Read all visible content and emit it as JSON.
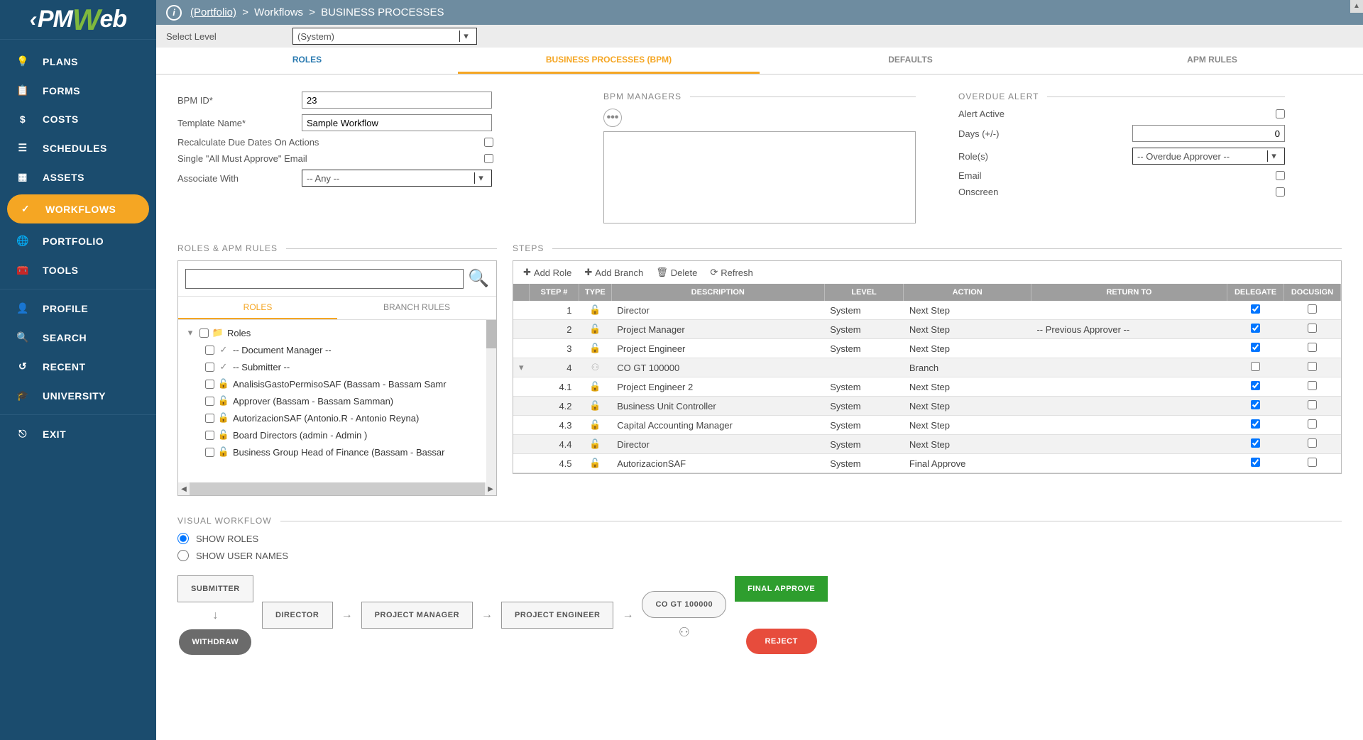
{
  "logo": {
    "pre": "PM",
    "w": "W",
    "post": "eb"
  },
  "sidebar": {
    "items": [
      {
        "label": "PLANS"
      },
      {
        "label": "FORMS"
      },
      {
        "label": "COSTS"
      },
      {
        "label": "SCHEDULES"
      },
      {
        "label": "ASSETS"
      },
      {
        "label": "WORKFLOWS"
      },
      {
        "label": "PORTFOLIO"
      },
      {
        "label": "TOOLS"
      }
    ],
    "bottom": [
      {
        "label": "PROFILE"
      },
      {
        "label": "SEARCH"
      },
      {
        "label": "RECENT"
      },
      {
        "label": "UNIVERSITY"
      }
    ],
    "exit": "EXIT"
  },
  "breadcrumb": {
    "portfolio": "(Portfolio)",
    "workflows": "Workflows",
    "bp": "BUSINESS PROCESSES"
  },
  "selectLevel": {
    "label": "Select Level",
    "value": "(System)"
  },
  "tabs": {
    "roles": "ROLES",
    "bpm": "BUSINESS PROCESSES (BPM)",
    "defaults": "DEFAULTS",
    "apm": "APM RULES"
  },
  "form": {
    "bpm_id_label": "BPM ID*",
    "bpm_id": "23",
    "template_label": "Template Name*",
    "template": "Sample Workflow",
    "recalc": "Recalculate Due Dates On Actions",
    "single": "Single \"All Must Approve\" Email",
    "associate_label": "Associate With",
    "associate": "-- Any --"
  },
  "managers": {
    "title": "BPM MANAGERS"
  },
  "alert": {
    "title": "OVERDUE ALERT",
    "active": "Alert Active",
    "days_label": "Days (+/-)",
    "days": "0",
    "roles_label": "Role(s)",
    "roles": "-- Overdue Approver --",
    "email": "Email",
    "onscreen": "Onscreen"
  },
  "rolesPanel": {
    "title": "ROLES & APM RULES",
    "tab_roles": "ROLES",
    "tab_branch": "BRANCH RULES",
    "root": "Roles",
    "items": [
      "-- Document Manager --",
      "-- Submitter --",
      "AnalisisGastoPermisoSAF (Bassam - Bassam Samr",
      "Approver (Bassam - Bassam Samman)",
      "AutorizacionSAF (Antonio.R - Antonio Reyna)",
      "Board Directors (admin - Admin )",
      "Business Group Head of Finance (Bassam - Bassar"
    ]
  },
  "steps": {
    "title": "STEPS",
    "toolbar": {
      "add_role": "Add Role",
      "add_branch": "Add Branch",
      "del": "Delete",
      "refresh": "Refresh"
    },
    "headers": {
      "step": "STEP #",
      "type": "TYPE",
      "desc": "DESCRIPTION",
      "level": "LEVEL",
      "action": "ACTION",
      "return": "RETURN TO",
      "delegate": "DELEGATE",
      "docusign": "DOCUSIGN"
    },
    "rows": [
      {
        "num": "1",
        "desc": "Director",
        "level": "System",
        "action": "Next Step",
        "ret": "",
        "delegate": true,
        "docusign": false,
        "sub": false,
        "branch": false
      },
      {
        "num": "2",
        "desc": "Project Manager",
        "level": "System",
        "action": "Next Step",
        "ret": "-- Previous Approver --",
        "delegate": true,
        "docusign": false,
        "sub": false,
        "branch": false
      },
      {
        "num": "3",
        "desc": "Project Engineer",
        "level": "System",
        "action": "Next Step",
        "ret": "",
        "delegate": true,
        "docusign": false,
        "sub": false,
        "branch": false
      },
      {
        "num": "4",
        "desc": "CO GT 100000",
        "level": "",
        "action": "Branch",
        "ret": "",
        "delegate": false,
        "docusign": false,
        "sub": false,
        "branch": true
      },
      {
        "num": "4.1",
        "desc": "Project Engineer 2",
        "level": "System",
        "action": "Next Step",
        "ret": "",
        "delegate": true,
        "docusign": false,
        "sub": true,
        "branch": false
      },
      {
        "num": "4.2",
        "desc": "Business Unit Controller",
        "level": "System",
        "action": "Next Step",
        "ret": "",
        "delegate": true,
        "docusign": false,
        "sub": true,
        "branch": false
      },
      {
        "num": "4.3",
        "desc": "Capital Accounting Manager",
        "level": "System",
        "action": "Next Step",
        "ret": "",
        "delegate": true,
        "docusign": false,
        "sub": true,
        "branch": false
      },
      {
        "num": "4.4",
        "desc": "Director",
        "level": "System",
        "action": "Next Step",
        "ret": "",
        "delegate": true,
        "docusign": false,
        "sub": true,
        "branch": false
      },
      {
        "num": "4.5",
        "desc": "AutorizacionSAF",
        "level": "System",
        "action": "Final Approve",
        "ret": "",
        "delegate": true,
        "docusign": false,
        "sub": true,
        "branch": false
      }
    ]
  },
  "visual": {
    "title": "VISUAL WORKFLOW",
    "show_roles": "SHOW ROLES",
    "show_users": "SHOW USER NAMES",
    "nodes": {
      "submitter": "SUBMITTER",
      "withdraw": "WITHDRAW",
      "director": "DIRECTOR",
      "pm": "PROJECT MANAGER",
      "pe": "PROJECT ENGINEER",
      "co": "CO GT 100000",
      "final": "FINAL APPROVE",
      "reject": "REJECT"
    }
  }
}
